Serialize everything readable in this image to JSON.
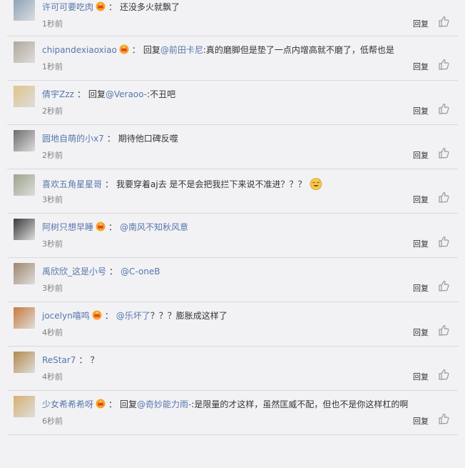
{
  "comments": [
    {
      "user": "许可可要吃肉",
      "vip": true,
      "reply_label": "",
      "mention": "",
      "text": "还没多火就飘了",
      "time": "1秒前",
      "avatar_color": "#8aa3b8"
    },
    {
      "user": "chipandexiaoxiao",
      "vip": true,
      "reply_label": "回复",
      "mention": "@前田卡尼",
      "text": ":真的磨脚但是垫了一点内增高就不磨了，低帮也是",
      "time": "1秒前",
      "avatar_color": "#b0a89a"
    },
    {
      "user": "倩宇Zzz",
      "vip": false,
      "reply_label": "回复",
      "mention": "@Veraoo-",
      "text": ":不丑吧",
      "time": "2秒前",
      "avatar_color": "#e0c48a"
    },
    {
      "user": "圆地自萌的小x7",
      "vip": false,
      "reply_label": "",
      "mention": "",
      "text": "期待他口碑反噬",
      "time": "2秒前",
      "avatar_color": "#6d6d6d"
    },
    {
      "user": "喜欢五角星星哥",
      "vip": false,
      "reply_label": "",
      "mention": "",
      "text": "我要穿着aj去 是不是会把我拦下来说不准进？？？",
      "time": "3秒前",
      "avatar_color": "#9aa48a",
      "emoji": true
    },
    {
      "user": "阿树只想早睡",
      "vip": true,
      "reply_label": "",
      "mention": "@南风不知秋风意",
      "text": "",
      "time": "3秒前",
      "avatar_color": "#3a3a3a"
    },
    {
      "user": "禹欣欣_这是小号",
      "vip": false,
      "reply_label": "",
      "mention": "@C-oneB",
      "text": "",
      "time": "3秒前",
      "avatar_color": "#a0866e"
    },
    {
      "user": "jocelyn嘻鸣",
      "vip": true,
      "reply_label": "",
      "mention": "@乐坏了",
      "text": "？？？膨胀成这样了",
      "time": "4秒前",
      "avatar_color": "#c97a3a"
    },
    {
      "user": "ReStar7",
      "vip": false,
      "reply_label": "",
      "mention": "",
      "text": "？",
      "time": "4秒前",
      "avatar_color": "#b58a4a"
    },
    {
      "user": "少女希希希呀",
      "vip": true,
      "reply_label": "回复",
      "mention": "@奇妙能力雨-",
      "text": ":是限量的才这样，虽然匡威不配，但也不是你这样杠的啊",
      "time": "6秒前",
      "avatar_color": "#d8b070"
    }
  ],
  "reply_button_label": "回复",
  "colors": {
    "link": "#5776aa",
    "time": "#808080",
    "divider": "#d9d9d9",
    "background": "#f2f2f5"
  }
}
